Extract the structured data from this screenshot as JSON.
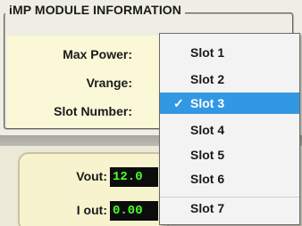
{
  "group": {
    "title": "iMP MODULE INFORMATION"
  },
  "fields": [
    {
      "label": "Max Power:"
    },
    {
      "label": "Vrange:"
    },
    {
      "label": "Slot Number:"
    }
  ],
  "meters": [
    {
      "label": "Vout:",
      "value": "12.0"
    },
    {
      "label": "I out:",
      "value": "0.00"
    }
  ],
  "slot_dropdown": {
    "selected": "Slot 3",
    "options": [
      "Slot 1",
      "Slot 2",
      "Slot 3",
      "Slot 4",
      "Slot 5",
      "Slot 6",
      "Slot 7"
    ],
    "check_glyph": "✓"
  },
  "colors": {
    "selection": "#3398e4",
    "meter_text": "#49ff2e",
    "meter_background": "#0c0c0c",
    "field_background": "#fbf8d8"
  }
}
